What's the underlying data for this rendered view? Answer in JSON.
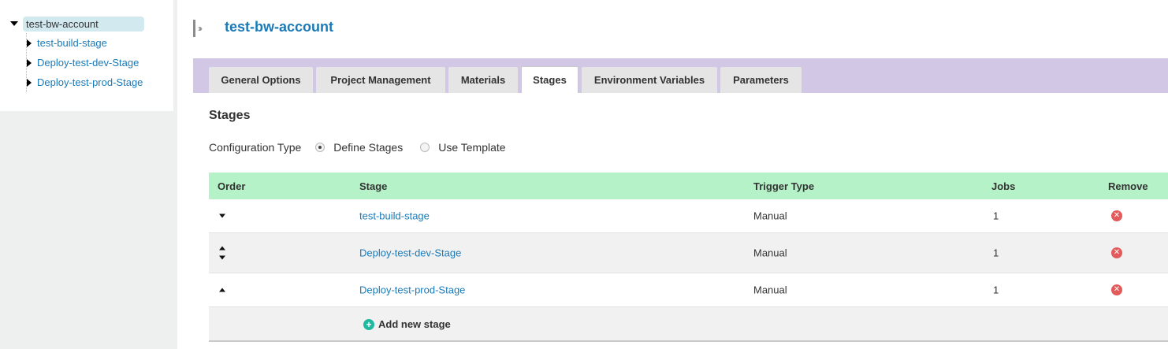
{
  "tree": {
    "root_label": "test-bw-account",
    "children": [
      {
        "label": "test-build-stage"
      },
      {
        "label": "Deploy-test-dev-Stage"
      },
      {
        "label": "Deploy-test-prod-Stage"
      }
    ]
  },
  "header": {
    "title": "test-bw-account",
    "icon": "pipeline-icon"
  },
  "tabs": [
    {
      "label": "General Options",
      "active": false
    },
    {
      "label": "Project Management",
      "active": false
    },
    {
      "label": "Materials",
      "active": false
    },
    {
      "label": "Stages",
      "active": true
    },
    {
      "label": "Environment Variables",
      "active": false
    },
    {
      "label": "Parameters",
      "active": false
    }
  ],
  "stages_section": {
    "title": "Stages",
    "config_type_label": "Configuration Type",
    "options": [
      {
        "label": "Define Stages",
        "checked": true
      },
      {
        "label": "Use Template",
        "checked": false
      }
    ]
  },
  "table": {
    "headers": {
      "order": "Order",
      "stage": "Stage",
      "trigger_type": "Trigger Type",
      "jobs": "Jobs",
      "remove": "Remove"
    },
    "rows": [
      {
        "stage": "test-build-stage",
        "trigger_type": "Manual",
        "jobs": "1",
        "order_controls": [
          "down"
        ]
      },
      {
        "stage": "Deploy-test-dev-Stage",
        "trigger_type": "Manual",
        "jobs": "1",
        "order_controls": [
          "up",
          "down"
        ]
      },
      {
        "stage": "Deploy-test-prod-Stage",
        "trigger_type": "Manual",
        "jobs": "1",
        "order_controls": [
          "up"
        ]
      }
    ],
    "add_stage_label": "Add new stage"
  },
  "colors": {
    "link": "#1a7ab8",
    "tabbar": "#d3c7e6",
    "table_header": "#b6f2c8",
    "remove_icon": "#e25a5a",
    "add_icon": "#20b8a0",
    "tree_selected": "#d2e9ef"
  }
}
